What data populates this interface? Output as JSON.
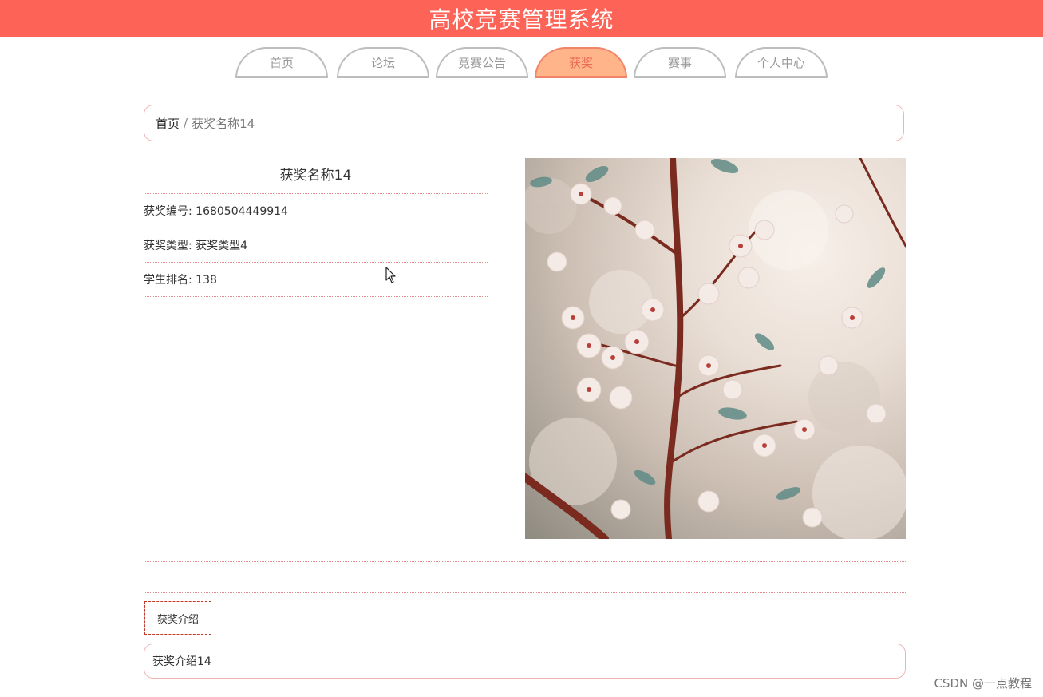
{
  "header": {
    "title": "高校竞赛管理系统"
  },
  "nav": {
    "items": [
      {
        "label": "首页"
      },
      {
        "label": "论坛"
      },
      {
        "label": "竞赛公告"
      },
      {
        "label": "获奖"
      },
      {
        "label": "赛事"
      },
      {
        "label": "个人中心"
      }
    ],
    "active_index": 3
  },
  "breadcrumb": {
    "home": "首页",
    "separator": "/",
    "current": "获奖名称14"
  },
  "award": {
    "name": "获奖名称14",
    "fields": [
      {
        "label": "获奖编号",
        "value": "1680504449914"
      },
      {
        "label": "获奖类型",
        "value": "获奖类型4"
      },
      {
        "label": "学生排名",
        "value": "138"
      }
    ]
  },
  "image": {
    "alt": "cherry-blossom-photo"
  },
  "intro": {
    "tab_label": "获奖介绍",
    "content": "获奖介绍14"
  },
  "watermark": "CSDN @一点教程",
  "colors": {
    "header_bg": "#fd6356",
    "active_tab_bg": "#ffb489",
    "border_pink": "#f0b4b4"
  }
}
